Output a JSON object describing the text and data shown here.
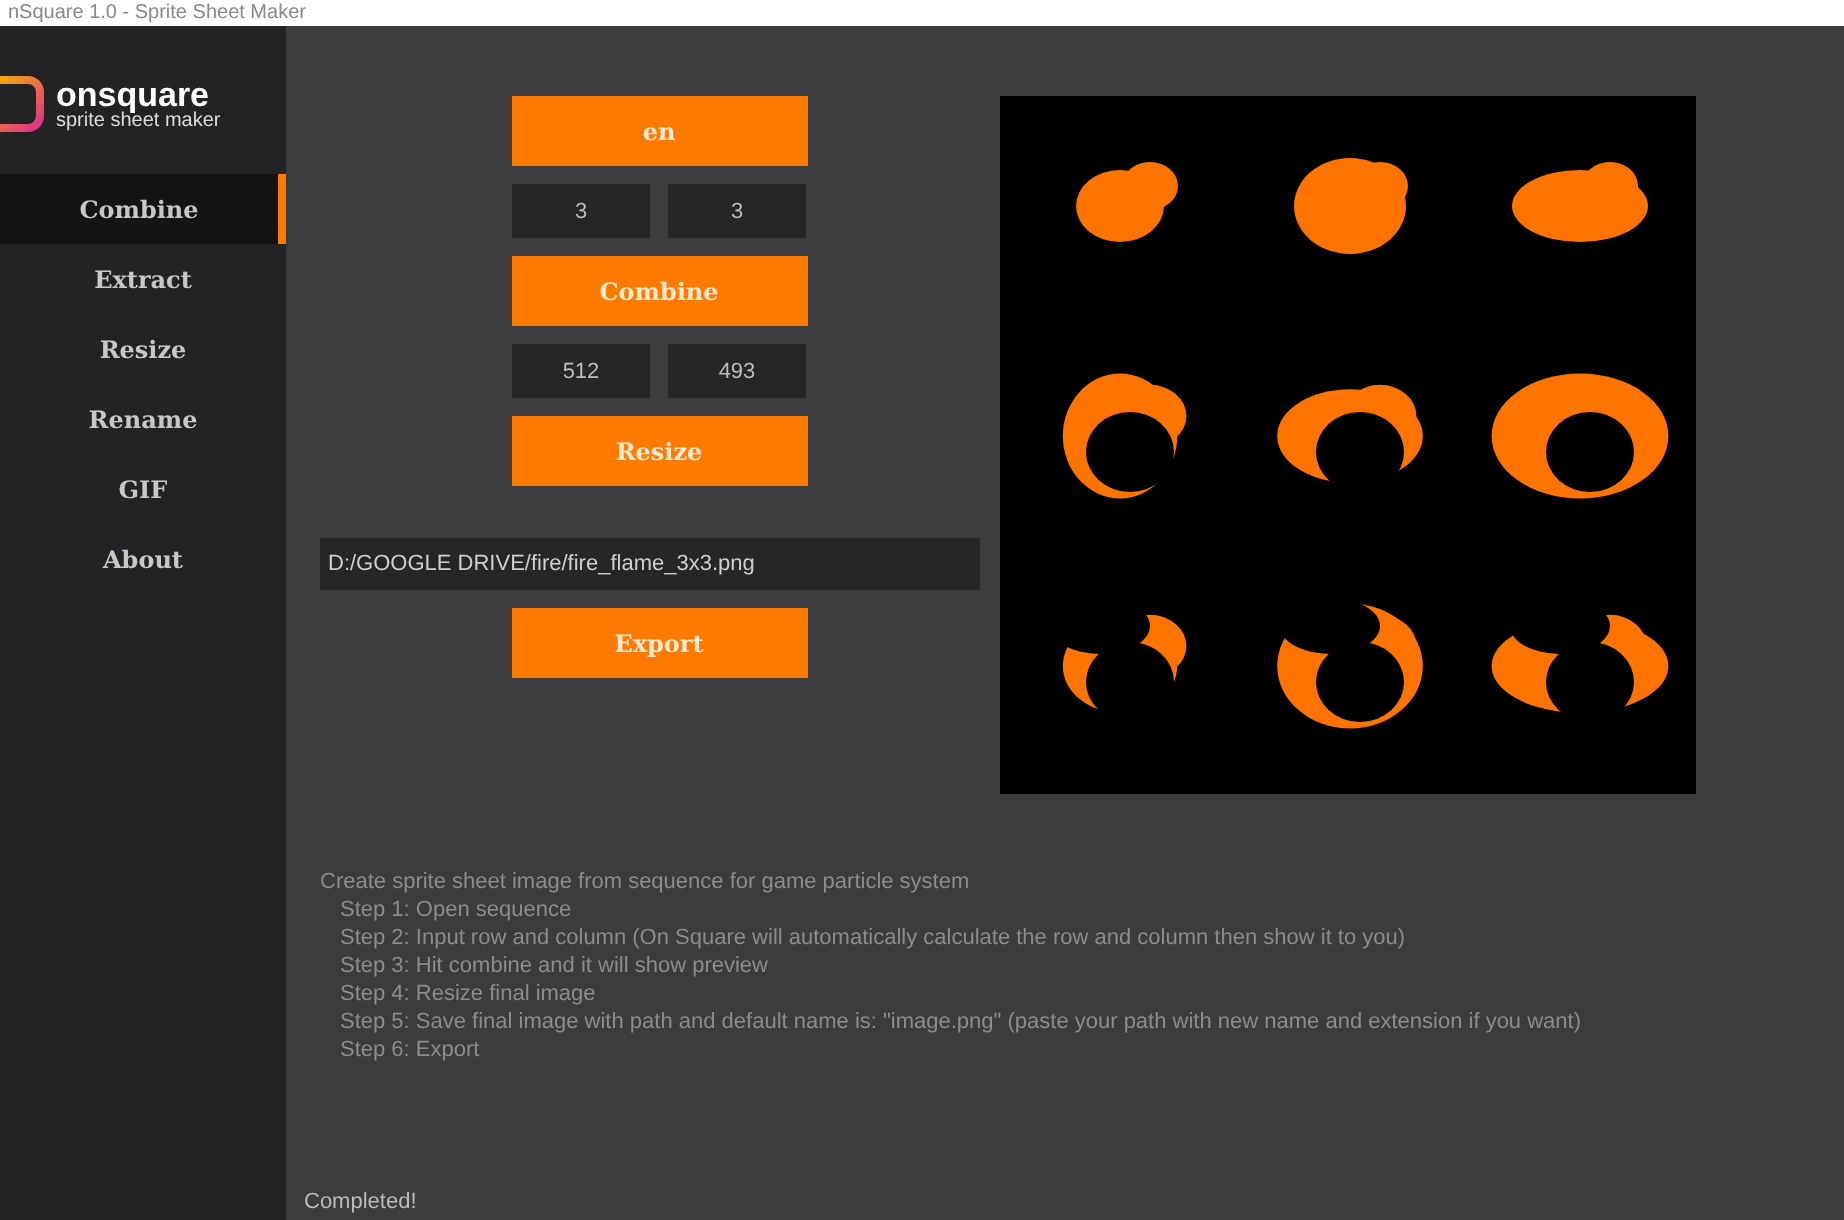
{
  "window": {
    "title": "nSquare 1.0 - Sprite Sheet Maker"
  },
  "logo": {
    "name": "onsquare",
    "tagline": "sprite sheet maker"
  },
  "sidebar": {
    "items": [
      {
        "label": "Combine",
        "selected": true
      },
      {
        "label": "Extract",
        "selected": false
      },
      {
        "label": "Resize",
        "selected": false
      },
      {
        "label": "Rename",
        "selected": false
      },
      {
        "label": "GIF",
        "selected": false
      },
      {
        "label": "About",
        "selected": false
      }
    ]
  },
  "open_button": {
    "label": "en"
  },
  "grid_fields": [
    {
      "value": "3"
    },
    {
      "value": "3"
    }
  ],
  "combine_button": {
    "label": "Combine"
  },
  "size_fields": [
    {
      "value": "512"
    },
    {
      "value": "493"
    }
  ],
  "resize_button": {
    "label": "Resize"
  },
  "path_field": {
    "value": "D:/GOOGLE DRIVE/fire/fire_flame_3x3.png"
  },
  "export_button": {
    "label": "Export"
  },
  "instructions": {
    "intro": "Create sprite sheet image from sequence for game particle system",
    "steps": [
      "Step 1: Open sequence",
      "Step 2: Input row and column (On Square will automatically calculate the row and column then show it to you)",
      "Step 3: Hit combine and it will show preview",
      "Step 4: Resize final image",
      "Step 5: Save final image with path and default name is: \"image.png\" (paste your path with new name and extension if you want)",
      "Step 6: Export"
    ]
  },
  "status_bar": {
    "text": "Completed!"
  }
}
